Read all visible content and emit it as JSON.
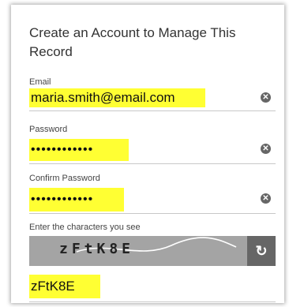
{
  "form": {
    "title": "Create an Account to Manage This Record",
    "email": {
      "label": "Email",
      "value": "maria.smith@email.com"
    },
    "password": {
      "label": "Password",
      "value": "••••••••••••"
    },
    "confirm_password": {
      "label": "Confirm Password",
      "value": "••••••••••••"
    },
    "captcha": {
      "label": "Enter the characters you see",
      "image_text": "zFtK8E",
      "input_value": "zFtK8E"
    }
  },
  "icons": {
    "clear": "clear-icon",
    "refresh": "refresh-icon"
  },
  "colors": {
    "highlight": "#ffff33",
    "refresh_bg": "#666666",
    "captcha_bg": "#a4a4a4"
  }
}
